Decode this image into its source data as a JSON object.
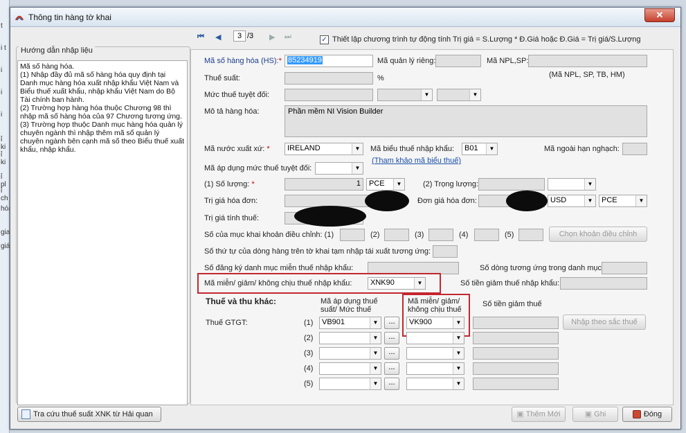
{
  "window": {
    "title": "Thông tin hàng tờ khai"
  },
  "left_strip": [
    "t",
    "i t",
    "i",
    "i",
    "i",
    "ỉ ki",
    "ỉ ki",
    "ỉ pl",
    "ỉ ch",
    "hóa",
    "gia",
    "giá"
  ],
  "nav": {
    "first": "⏮",
    "prev": "◀",
    "current": "3",
    "total": "/3",
    "next": "▶",
    "last": "⏭",
    "auto_calc_checked": true,
    "auto_calc_label": "Thiết lập chương trình tự động tính Trị giá = S.Lượng * Đ.Giá hoặc Đ.Giá = Trị giá/S.Lượng"
  },
  "guide": {
    "title": "Hướng dẫn nhập liệu",
    "text": "Mã số hàng hóa.\n(1) Nhập đầy đủ mã số hàng hóa quy định tại Danh mục hàng hóa xuất nhập khẩu Việt Nam và Biểu thuế xuất khẩu, nhập khẩu Việt Nam do Bộ Tài chính ban hành.\n(2) Trường hợp hàng hóa thuộc Chương 98 thì nhập mã số hàng hóa của 97 Chương tương ứng.\n(3) Trường hợp thuộc Danh mục hàng hóa quản lý chuyên ngành thì nhập thêm mã số quản lý chuyên ngành bên cạnh mã số theo Biểu thuế xuất khẩu, nhập khẩu."
  },
  "form": {
    "hs_label": "Mã số hàng hóa (HS):",
    "req_mark": "*",
    "hs_value": "85234919",
    "qlr_label": "Mã quản lý riêng:",
    "npl_label": "Mã NPL,SP:",
    "npl_hint": "(Mã NPL, SP, TB, HM)",
    "thuesuat_label": "Thuế suất:",
    "percent": "%",
    "mucthue_label": "Mức thuế tuyệt đối:",
    "mota_label": "Mô tả hàng hóa:",
    "mota_value": "Phần mềm NI Vision Builder",
    "nuocxx_label": "Mã nước xuất xứ:",
    "nuocxx_value": "IRELAND",
    "bieuthue_label": "Mã biểu thuế nhập khẩu:",
    "bieuthue_value": "B01",
    "thamkhao_link": "(Tham khảo mã biểu thuế)",
    "ngoaihan_label": "Mã ngoài hạn nghạch:",
    "apdung_label": "Mã áp dụng mức thuế tuyệt đối:",
    "soluong_label": "(1) Số lượng:",
    "soluong_value": "1",
    "soluong_unit": "PCE",
    "trongluong_label": "(2) Trọng lượng:",
    "trigiahd_label": "Trị giá hóa đơn:",
    "dongia_label": "Đơn giá hóa đơn:",
    "currency": "USD",
    "dongia_unit": "PCE",
    "trigiatt_label": "Trị giá tính thuế:",
    "dieuchinh_label": "Số của mục khai khoản điều chỉnh: (1)",
    "dc2": "(2)",
    "dc3": "(3)",
    "dc4": "(4)",
    "dc5": "(5)",
    "chon_dieuchinh_btn": "Chọn khoản điều chỉnh",
    "sothutu_label": "Số thứ tự của dòng hàng trên tờ khai tạm nhập tái xuất tương ứng:",
    "sodangky_label": "Số đăng ký danh mục miễn thuế nhập khẩu:",
    "sodong_label": "Số dòng tương ứng trong danh mục:",
    "mienthue_label": "Mã miễn/ giảm/ không chịu thuế nhập khẩu:",
    "mienthue_value": "XNK90",
    "sotiengiam_label": "Số tiền giảm thuế nhập khẩu:",
    "thue_section": "Thuế và thu khác:",
    "col_apdung": "Mã áp dụng thuế suất/ Mức thuế",
    "col_mien": "Mã miễn/ giảm/ không chịu thuế",
    "col_sotien": "Số tiền giảm thuế",
    "thue_gtgt": "Thuế GTGT:",
    "rows": [
      {
        "idx": "(1)",
        "apdung": "VB901",
        "mien": "VK900"
      },
      {
        "idx": "(2)",
        "apdung": "",
        "mien": ""
      },
      {
        "idx": "(3)",
        "apdung": "",
        "mien": ""
      },
      {
        "idx": "(4)",
        "apdung": "",
        "mien": ""
      },
      {
        "idx": "(5)",
        "apdung": "",
        "mien": ""
      }
    ],
    "dots": "...",
    "nhap_theo_sac_thue_btn": "Nhập theo sắc thuế"
  },
  "footer": {
    "tra_cuu_btn": "Tra cứu thuế suất XNK từ Hải quan",
    "them_moi_btn": "Thêm Mới",
    "ghi_btn": "Ghi",
    "dong_btn": "Đóng"
  },
  "colors": {
    "highlight_border": "#c4262e",
    "hs_selection": "#3399ff",
    "label_blue": "#1a3c8c"
  }
}
